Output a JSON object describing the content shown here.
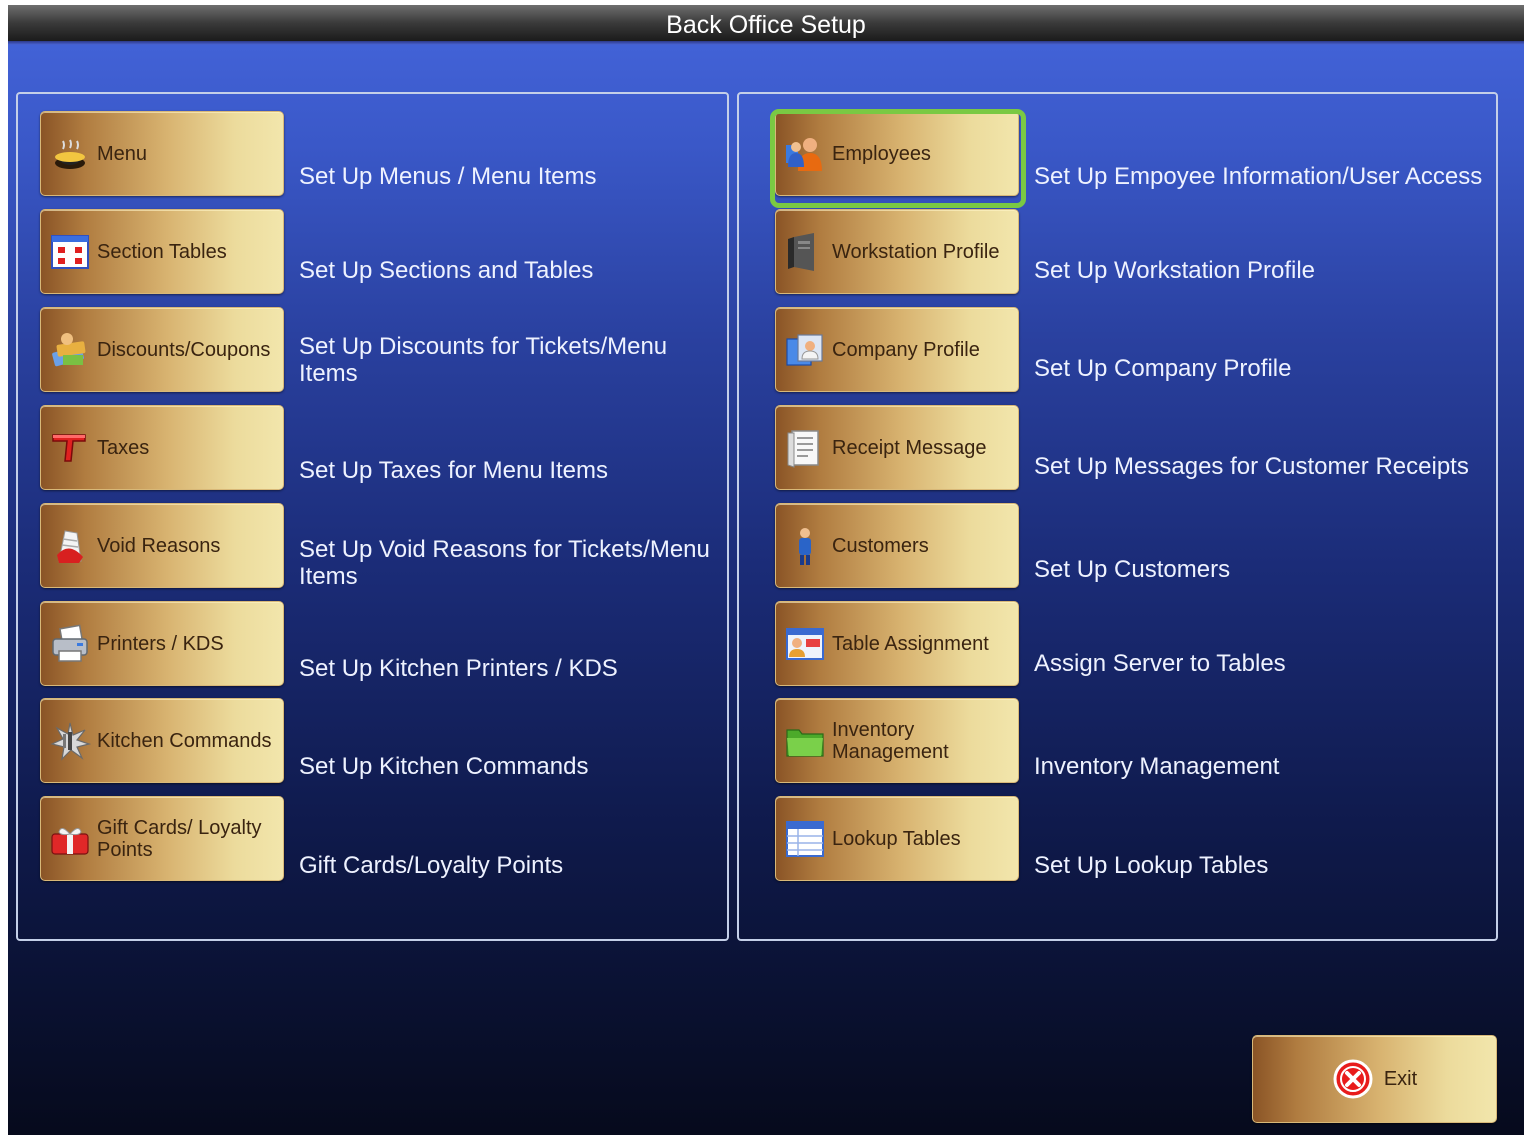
{
  "window": {
    "title": "Back Office Setup"
  },
  "left_panel": {
    "items": [
      {
        "label": "Menu",
        "description": "Set Up Menus /  Menu Items",
        "icon": "menu-bowl-icon"
      },
      {
        "label": "Section Tables",
        "description": "Set Up Sections  and  Tables",
        "icon": "section-tables-icon"
      },
      {
        "label": "Discounts/Coupons",
        "description": "Set Up Discounts for Tickets/Menu Items",
        "icon": "coupons-icon"
      },
      {
        "label": "Taxes",
        "description": "Set Up Taxes for Menu Items",
        "icon": "taxes-icon"
      },
      {
        "label": "Void Reasons",
        "description": "Set Up Void Reasons for Tickets/Menu Items",
        "icon": "void-reasons-icon"
      },
      {
        "label": "Printers / KDS",
        "description": "Set Up Kitchen Printers / KDS",
        "icon": "printer-icon"
      },
      {
        "label": "Kitchen Commands",
        "description": "Set Up Kitchen Commands",
        "icon": "kitchen-commands-icon"
      },
      {
        "label": "Gift Cards/ Loyalty Points",
        "description": "Gift Cards/Loyalty Points",
        "icon": "gift-cards-icon"
      }
    ]
  },
  "right_panel": {
    "items": [
      {
        "label": "Employees",
        "description": "Set Up Empoyee Information/User Access",
        "icon": "employees-icon",
        "selected": true
      },
      {
        "label": "Workstation Profile",
        "description": "Set Up Workstation Profile",
        "icon": "workstation-icon"
      },
      {
        "label": "Company Profile",
        "description": "Set Up Company Profile",
        "icon": "company-profile-icon"
      },
      {
        "label": "Receipt Message",
        "description": "Set Up Messages for Customer Receipts",
        "icon": "receipt-icon"
      },
      {
        "label": "Customers",
        "description": "Set Up Customers",
        "icon": "customer-icon"
      },
      {
        "label": "Table Assignment",
        "description": "Assign Server to Tables",
        "icon": "table-assignment-icon"
      },
      {
        "label": "Inventory Management",
        "description": "Inventory Management",
        "icon": "folder-icon"
      },
      {
        "label": "Lookup Tables",
        "description": "Set Up Lookup Tables",
        "icon": "lookup-tables-icon"
      }
    ]
  },
  "exit": {
    "label": "Exit",
    "icon": "exit-x-icon"
  },
  "colors": {
    "selection_outline": "#7ac943",
    "title_bar": "#2a2a2a",
    "background_top": "#4566dc",
    "background_bottom": "#060a1c",
    "button_gold": "#e8d294"
  }
}
